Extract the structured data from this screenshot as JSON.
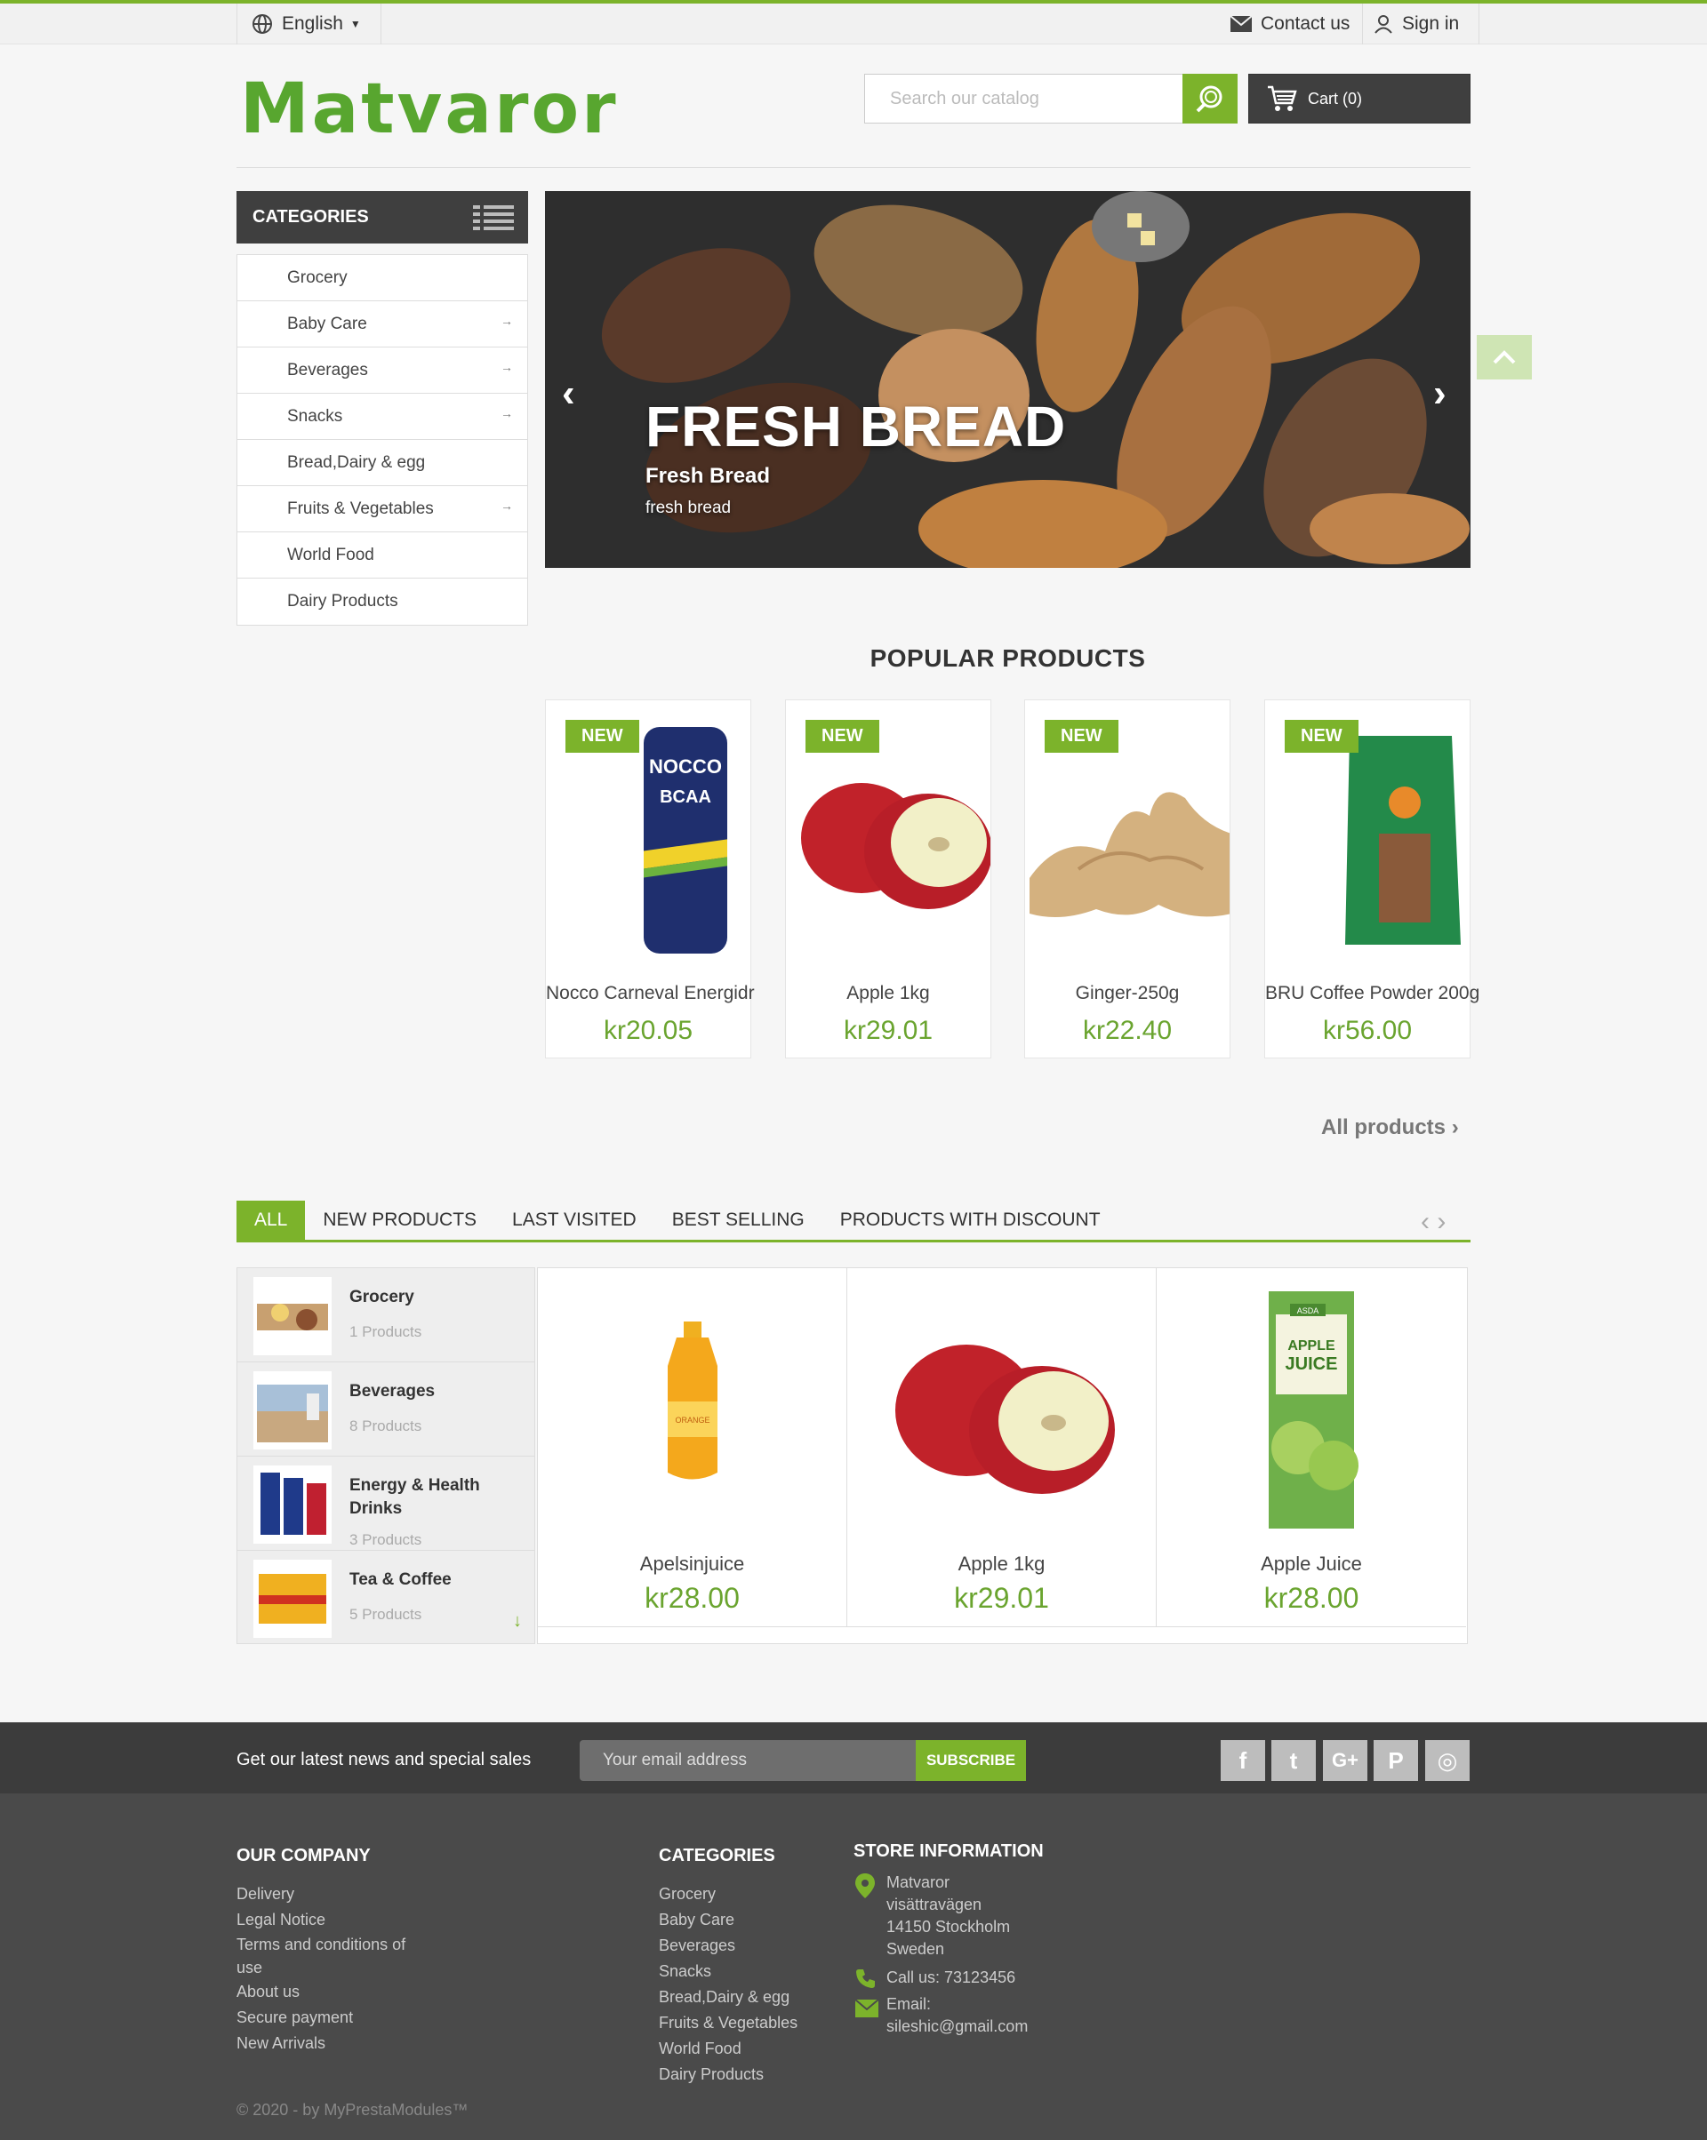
{
  "topbar": {
    "language": "English",
    "contact": "Contact us",
    "signin": "Sign in"
  },
  "header": {
    "logo": "Matvaror",
    "search_placeholder": "Search our catalog",
    "cart": "Cart (0)"
  },
  "categories": {
    "title": "CATEGORIES",
    "items": [
      {
        "label": "Grocery",
        "arrow": ""
      },
      {
        "label": "Baby Care",
        "arrow": "→"
      },
      {
        "label": "Beverages",
        "arrow": "→"
      },
      {
        "label": "Snacks",
        "arrow": "→"
      },
      {
        "label": "Bread,Dairy & egg",
        "arrow": ""
      },
      {
        "label": "Fruits & Vegetables",
        "arrow": "→"
      },
      {
        "label": "World Food",
        "arrow": ""
      },
      {
        "label": "Dairy Products",
        "arrow": ""
      }
    ]
  },
  "slider": {
    "title": "FRESH BREAD",
    "subtitle": "Fresh Bread",
    "description": "fresh bread"
  },
  "popular": {
    "title": "POPULAR PRODUCTS",
    "badge": "NEW",
    "products": [
      {
        "name": "Nocco Carneval Energidr",
        "price": "kr20.05"
      },
      {
        "name": "Apple 1kg",
        "price": "kr29.01"
      },
      {
        "name": "Ginger-250g",
        "price": "kr22.40"
      },
      {
        "name": "BRU Coffee Powder 200g",
        "price": "kr56.00"
      }
    ],
    "all_products": "All products"
  },
  "tabs": {
    "items": [
      "ALL",
      "NEW PRODUCTS",
      "LAST VISITED",
      "BEST SELLING",
      "PRODUCTS WITH DISCOUNT"
    ],
    "side_categories": [
      {
        "name": "Grocery",
        "count": "1 Products"
      },
      {
        "name": "Beverages",
        "count": "8 Products"
      },
      {
        "name": "Energy & Health Drinks",
        "count": "3 Products"
      },
      {
        "name": "Tea & Coffee",
        "count": "5 Products"
      }
    ],
    "products": [
      {
        "name": "Apelsinjuice",
        "price": "kr28.00"
      },
      {
        "name": "Apple 1kg",
        "price": "kr29.01"
      },
      {
        "name": "Apple Juice",
        "price": "kr28.00"
      }
    ],
    "juice_box": {
      "brand": "ASDA",
      "line1": "APPLE",
      "line2": "JUICE"
    },
    "orange_label": "ORANGE"
  },
  "newsletter": {
    "text": "Get our latest news and special sales",
    "placeholder": "Your email address",
    "button": "SUBSCRIBE"
  },
  "social": {
    "facebook": "f",
    "twitter": "t",
    "google": "G+",
    "pinterest": "P",
    "instagram": "◎"
  },
  "footer": {
    "company": {
      "title": "OUR COMPANY",
      "links": [
        "Delivery",
        "Legal Notice",
        "Terms and conditions of",
        "use",
        "About us",
        "Secure payment",
        "New Arrivals"
      ]
    },
    "categories": {
      "title": "CATEGORIES",
      "links": [
        "Grocery",
        "Baby Care",
        "Beverages",
        "Snacks",
        "Bread,Dairy & egg",
        "Fruits & Vegetables",
        "World Food",
        "Dairy Products"
      ]
    },
    "store": {
      "title": "STORE INFORMATION",
      "address": [
        "Matvaror",
        "visättravägen",
        "14150 Stockholm",
        "Sweden"
      ],
      "phone": "Call us: 73123456",
      "email_label": "Email:",
      "email": "sileshic@gmail.com"
    },
    "copyright": "© 2020 - by MyPrestaModules™"
  },
  "nocco": {
    "brand": "NOCCO",
    "line": "BCAA"
  },
  "colors": {
    "accent": "#7cb32b",
    "price": "#6aa42f",
    "dark": "#3f3f3f"
  }
}
